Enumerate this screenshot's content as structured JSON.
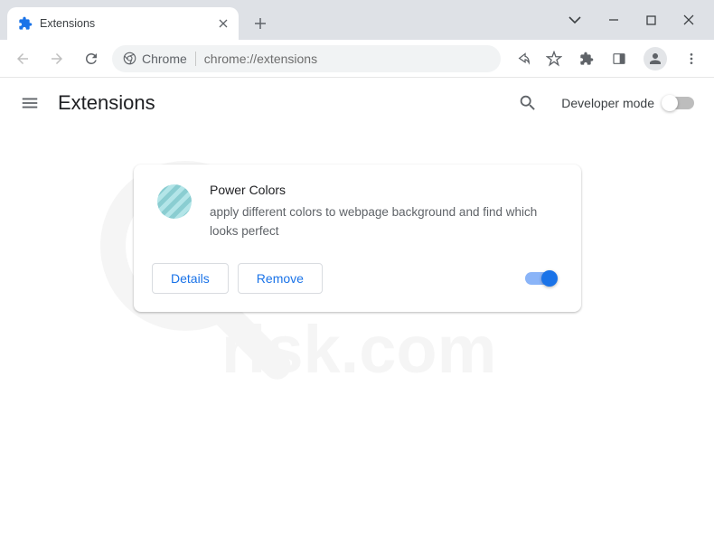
{
  "tab": {
    "title": "Extensions"
  },
  "omnibox": {
    "prefix": "Chrome",
    "url": "chrome://extensions"
  },
  "page": {
    "title": "Extensions",
    "developer_mode_label": "Developer mode"
  },
  "extension": {
    "name": "Power Colors",
    "description": "apply different colors to webpage background and find which looks perfect",
    "details_label": "Details",
    "remove_label": "Remove",
    "enabled": true
  }
}
